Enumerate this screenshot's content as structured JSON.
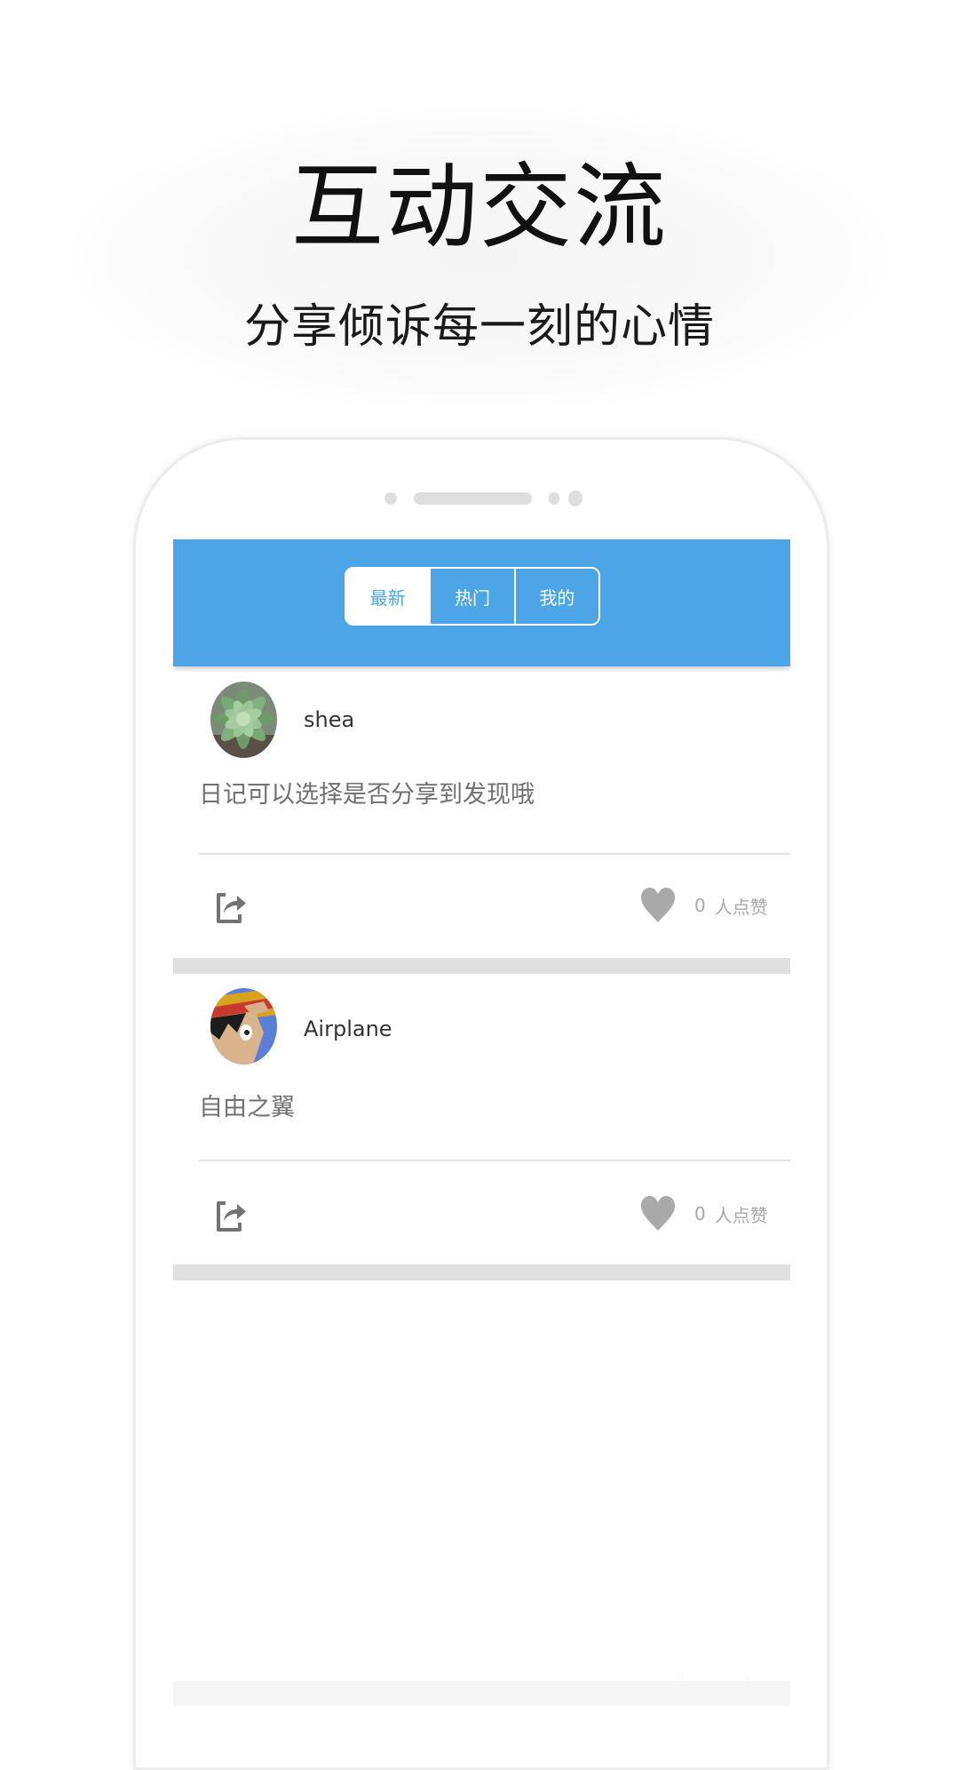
{
  "promo": {
    "title": "互动交流",
    "subtitle": "分享倾诉每一刻的心情"
  },
  "app": {
    "accent_color": "#4ba5e6",
    "tabs": [
      {
        "label": "最新",
        "active": true
      },
      {
        "label": "热门",
        "active": false
      },
      {
        "label": "我的",
        "active": false
      }
    ],
    "posts": [
      {
        "username": "shea",
        "avatar": "succulent-plant-photo",
        "content": "日记可以选择是否分享到发现哦",
        "like_count": "0",
        "like_label": "人点赞"
      },
      {
        "username": "Airplane",
        "avatar": "anime-character-straw-hat",
        "content": "自由之翼",
        "like_count": "0",
        "like_label": "人点赞"
      }
    ],
    "icons": {
      "share": "share-icon",
      "like": "heart-icon"
    }
  }
}
